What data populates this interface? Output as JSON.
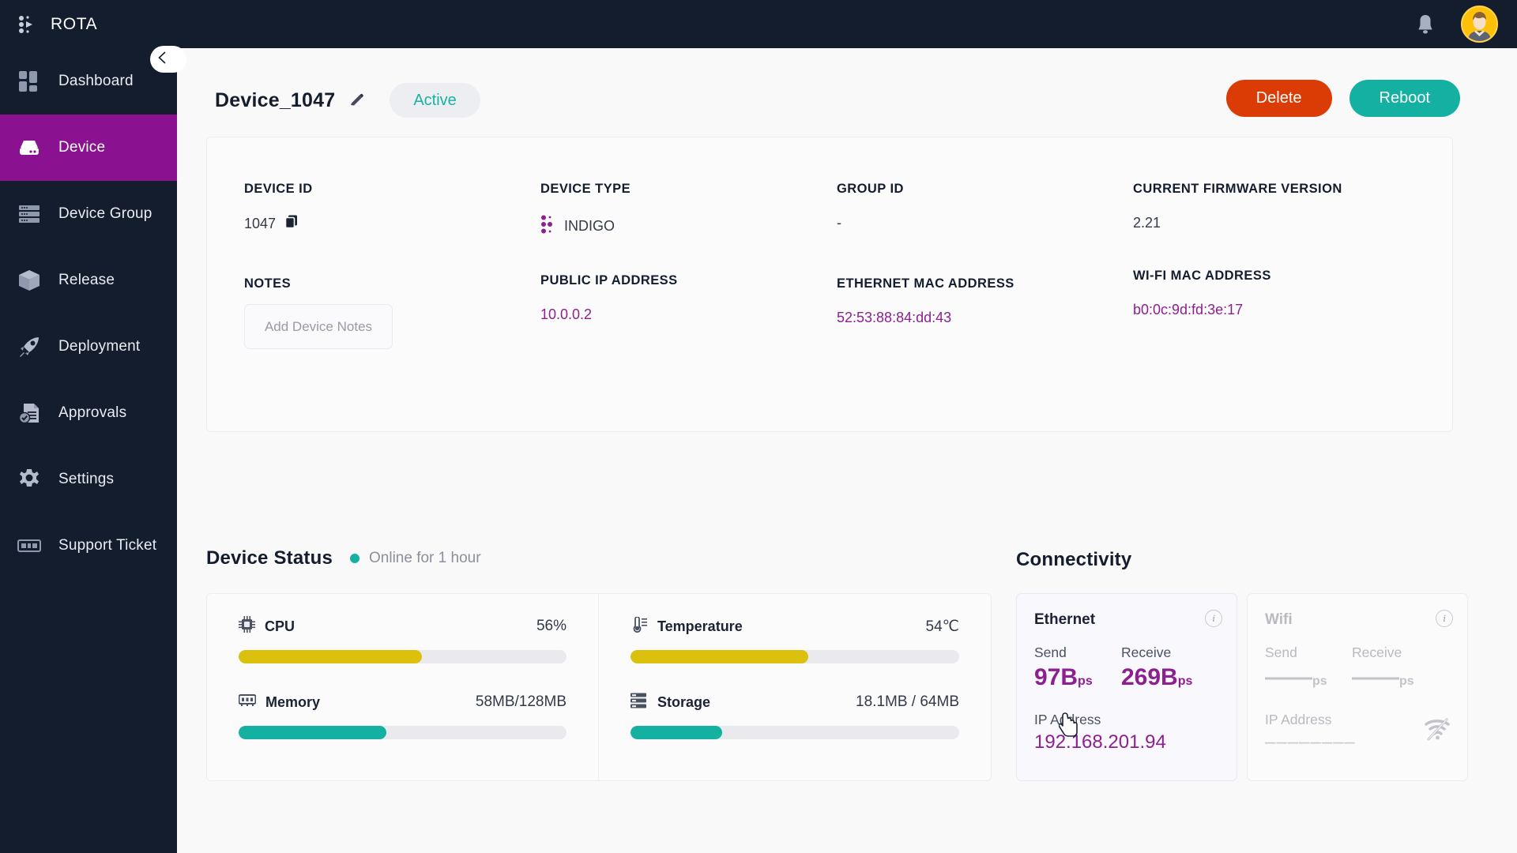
{
  "brand": {
    "name": "ROTA",
    "logo_icon": "rota-dots-icon"
  },
  "topbar": {
    "notifications_icon": "bell-icon",
    "avatar_icon": "user-avatar",
    "loading_bar_color": "#1878cf"
  },
  "sidebar": {
    "collapse_icon": "chevron-left-icon",
    "items": [
      {
        "label": "Dashboard",
        "icon": "dashboard-grid-icon",
        "active": false
      },
      {
        "label": "Device",
        "icon": "device-server-icon",
        "active": true
      },
      {
        "label": "Device Group",
        "icon": "device-group-icon",
        "active": false
      },
      {
        "label": "Release",
        "icon": "package-box-icon",
        "active": false
      },
      {
        "label": "Deployment",
        "icon": "rocket-icon",
        "active": false
      },
      {
        "label": "Approvals",
        "icon": "document-check-icon",
        "active": false
      },
      {
        "label": "Settings",
        "icon": "gear-icon",
        "active": false
      },
      {
        "label": "Support Ticket",
        "icon": "ticket-icon",
        "active": false
      }
    ]
  },
  "page": {
    "device_title": "Device_1047",
    "edit_icon": "pencil-icon",
    "status_label": "Active",
    "delete_label": "Delete",
    "reboot_label": "Reboot"
  },
  "info": {
    "row1": [
      {
        "label": "DEVICE ID",
        "value": "1047",
        "icon": "copy-icon",
        "link": false
      },
      {
        "label": "DEVICE TYPE",
        "value": "INDIGO",
        "icon": "indigo-dots-icon",
        "link": false
      },
      {
        "label": "GROUP ID",
        "value": "-",
        "icon": null,
        "link": false
      },
      {
        "label": "CURRENT FIRMWARE VERSION",
        "value": "2.21",
        "icon": null,
        "link": false
      }
    ],
    "row2": [
      {
        "label": "NOTES",
        "value": "",
        "placeholder": "Add Device Notes",
        "link": false
      },
      {
        "label": "PUBLIC IP ADDRESS",
        "value": "10.0.0.2",
        "link": true
      },
      {
        "label": "ETHERNET MAC ADDRESS",
        "value": "52:53:88:84:dd:43",
        "link": true
      },
      {
        "label": "WI-FI MAC ADDRESS",
        "value": "b0:0c:9d:fd:3e:17",
        "link": true
      }
    ]
  },
  "device_status": {
    "title": "Device Status",
    "online_text": "Online for 1 hour",
    "online_color": "#14b0a2",
    "metrics": [
      {
        "name": "CPU",
        "icon": "cpu-chip-icon",
        "value": "56%",
        "percent": 56,
        "color": "#dbc10d"
      },
      {
        "name": "Memory",
        "icon": "memory-ram-icon",
        "value": "58MB/128MB",
        "percent": 45,
        "color": "#14b0a2"
      },
      {
        "name": "Temperature",
        "icon": "thermometer-icon",
        "value": "54℃",
        "percent": 54,
        "color": "#dbc10d"
      },
      {
        "name": "Storage",
        "icon": "storage-disk-icon",
        "value": "18.1MB / 64MB",
        "percent": 28,
        "color": "#14b0a2"
      }
    ]
  },
  "connectivity": {
    "title": "Connectivity",
    "cards": [
      {
        "name": "Ethernet",
        "enabled": true,
        "info_icon": "info-circle-icon",
        "send_label": "Send",
        "send_value": "97B",
        "send_unit": "ps",
        "receive_label": "Receive",
        "receive_value": "269B",
        "receive_unit": "ps",
        "ip_label": "IP Address",
        "ip_value": "192.168.201.94"
      },
      {
        "name": "Wifi",
        "enabled": false,
        "info_icon": "info-circle-icon",
        "send_label": "Send",
        "send_value": "——",
        "send_unit": "ps",
        "receive_label": "Receive",
        "receive_value": "——",
        "receive_unit": "ps",
        "ip_label": "IP Address",
        "ip_value": "––––––––",
        "offline_icon": "wifi-off-icon"
      }
    ]
  },
  "colors": {
    "sidebar_bg": "#141d2e",
    "active_nav": "#8a1291",
    "accent_purple": "#8d2090",
    "teal": "#14b0a2",
    "danger": "#db3c06",
    "yellow": "#dbc10d"
  },
  "cursor": {
    "icon": "pointing-hand-cursor"
  }
}
